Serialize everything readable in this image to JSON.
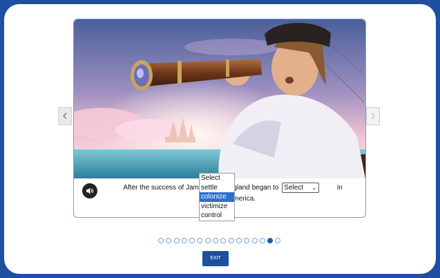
{
  "sentence": {
    "before": "After the success of Jamestown, England began to",
    "after": "in",
    "line2": "North America."
  },
  "select": {
    "value": "Select",
    "options": [
      "Select",
      "settle",
      "colonize",
      "victimize",
      "control"
    ],
    "highlighted_index": 2
  },
  "carousel": {
    "prev_arrow": "‹",
    "next_arrow": "›",
    "total_dots": 16,
    "active_index": 14
  },
  "exit_label": "EXIT",
  "colors": {
    "border": "#1f4fa0",
    "accent": "#1f5ea8",
    "highlight": "#2f6fd0"
  },
  "icons": {
    "audio": "speaker-icon"
  }
}
